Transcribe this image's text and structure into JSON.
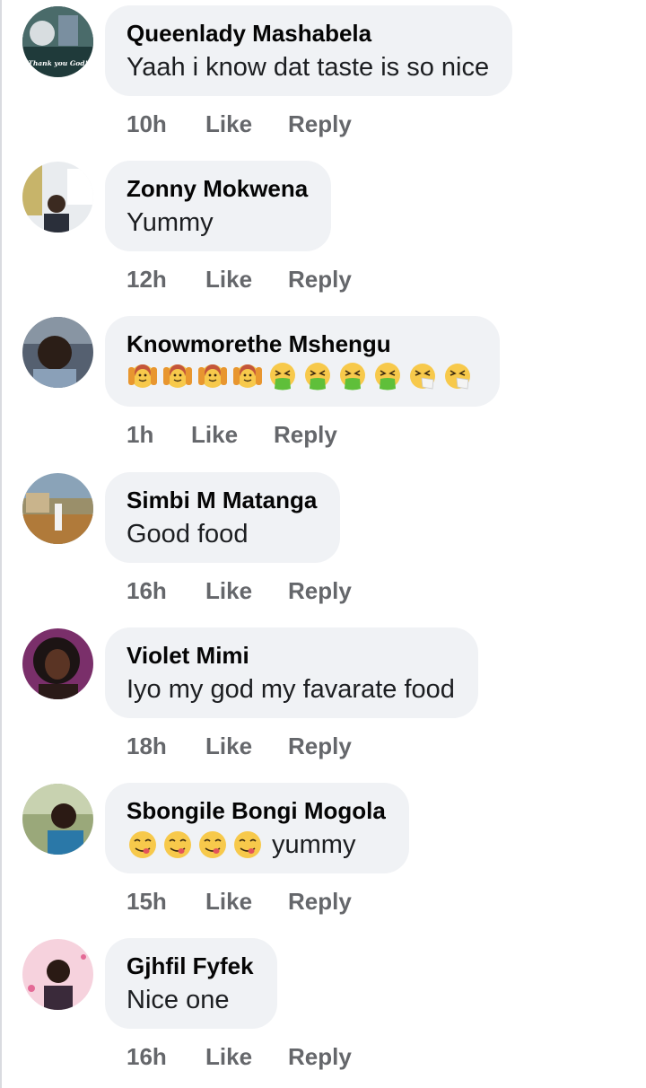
{
  "comments": [
    {
      "author": "Queenlady Mashabela",
      "text": "Yaah i know dat taste is so nice",
      "time": "10h",
      "like": "Like",
      "reply": "Reply",
      "avatar": "avatar-thank-you-god"
    },
    {
      "author": "Zonny Mokwena",
      "text": "Yummy",
      "time": "12h",
      "like": "Like",
      "reply": "Reply",
      "avatar": "avatar-person"
    },
    {
      "author": "Knowmorethe Mshengu",
      "text": "",
      "emojis": [
        "face-palms-up-emoji",
        "face-palms-up-emoji",
        "face-palms-up-emoji",
        "face-palms-up-emoji",
        "vomiting-face-emoji",
        "vomiting-face-emoji",
        "vomiting-face-emoji",
        "vomiting-face-emoji",
        "sneezing-face-emoji",
        "sneezing-face-emoji"
      ],
      "time": "1h",
      "like": "Like",
      "reply": "Reply",
      "avatar": "avatar-person"
    },
    {
      "author": "Simbi M Matanga",
      "text": "Good food",
      "time": "16h",
      "like": "Like",
      "reply": "Reply",
      "avatar": "avatar-outdoor"
    },
    {
      "author": "Violet Mimi",
      "text": "Iyo my god my favarate food",
      "time": "18h",
      "like": "Like",
      "reply": "Reply",
      "avatar": "avatar-person"
    },
    {
      "author": "Sbongile Bongi Mogola",
      "text": "yummy",
      "emojis": [
        "savoring-food-emoji",
        "savoring-food-emoji",
        "savoring-food-emoji",
        "savoring-food-emoji"
      ],
      "time": "15h",
      "like": "Like",
      "reply": "Reply",
      "avatar": "avatar-person"
    },
    {
      "author": "Gjhfil Fyfek",
      "text": "Nice one",
      "time": "16h",
      "like": "Like",
      "reply": "Reply",
      "avatar": "avatar-person-pink"
    }
  ],
  "avatar_badge": "Thank you God!",
  "colors": {
    "bubble": "#f0f2f5",
    "action_text": "#65676b",
    "author_text": "#050505"
  }
}
